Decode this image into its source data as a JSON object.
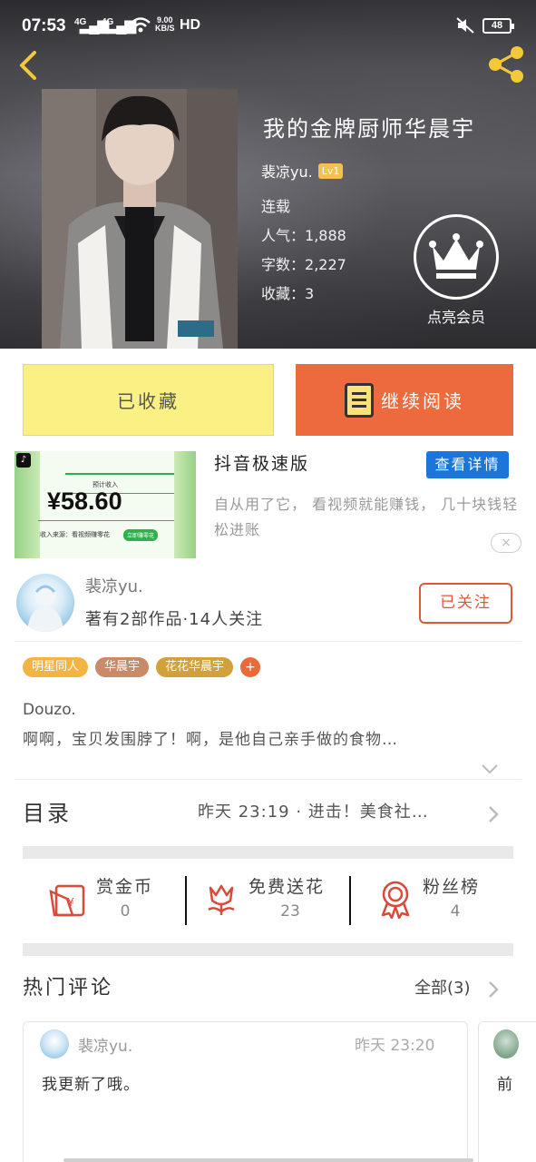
{
  "status_bar": {
    "time": "07:53",
    "network_1": "4G",
    "network_2": "4G",
    "speed_value": "9.00",
    "speed_unit": "KB/S",
    "hd": "HD",
    "battery": "48"
  },
  "book": {
    "title": "我的金牌厨师华晨宇",
    "author": "裴凉yu.",
    "author_level": "Lv1",
    "status": "连载",
    "popularity_label": "人气：",
    "popularity": "1,888",
    "words_label": "字数：",
    "words": "2,227",
    "favorites_label": "收藏：",
    "favorites": "3"
  },
  "vip": {
    "label": "点亮会员",
    "icon": "crown-icon"
  },
  "actions": {
    "favorited": "已收藏",
    "continue_reading": "继续阅读"
  },
  "ad": {
    "app_name": "抖音极速版",
    "detail_button": "查看详情",
    "description": "自从用了它， 看视频就能赚钱， 几十块钱轻松进账",
    "image_caption": "预计收入",
    "image_amount": "¥58.60",
    "image_source": "收入来源：看视频赚零花",
    "image_cta": "立即赚零花",
    "close": "×"
  },
  "author_card": {
    "name": "裴凉yu.",
    "stats": "著有2部作品·14人关注",
    "follow_button": "已关注"
  },
  "tags": [
    {
      "label": "明星同人",
      "color": "#f3b443"
    },
    {
      "label": "华晨宇",
      "color": "#c98a6a"
    },
    {
      "label": "花花华晨宇",
      "color": "#d2a13c"
    }
  ],
  "tag_add": "+",
  "summary": {
    "line1": "Douzo.",
    "line2": "啊啊，宝贝发围脖了！啊，是他自己亲手做的食物…"
  },
  "catalog": {
    "title": "目录",
    "latest": "昨天 23:19 · 进击！美食社…"
  },
  "stats": [
    {
      "label": "赏金币",
      "value": "0",
      "icon": "red-envelope-icon"
    },
    {
      "label": "免费送花",
      "value": "23",
      "icon": "flower-icon"
    },
    {
      "label": "粉丝榜",
      "value": "4",
      "icon": "medal-icon"
    }
  ],
  "comments": {
    "title": "热门评论",
    "all_label": "全部(3)",
    "items": [
      {
        "user": "裴凉yu.",
        "time": "昨天 23:20",
        "text": "我更新了哦。"
      },
      {
        "user": "",
        "time": "",
        "text": "前"
      }
    ]
  },
  "colors": {
    "accent_orange": "#ec6a3e",
    "fav_yellow": "#fbf084",
    "ad_blue": "#1c75d8",
    "follow_red": "#e0583a"
  }
}
